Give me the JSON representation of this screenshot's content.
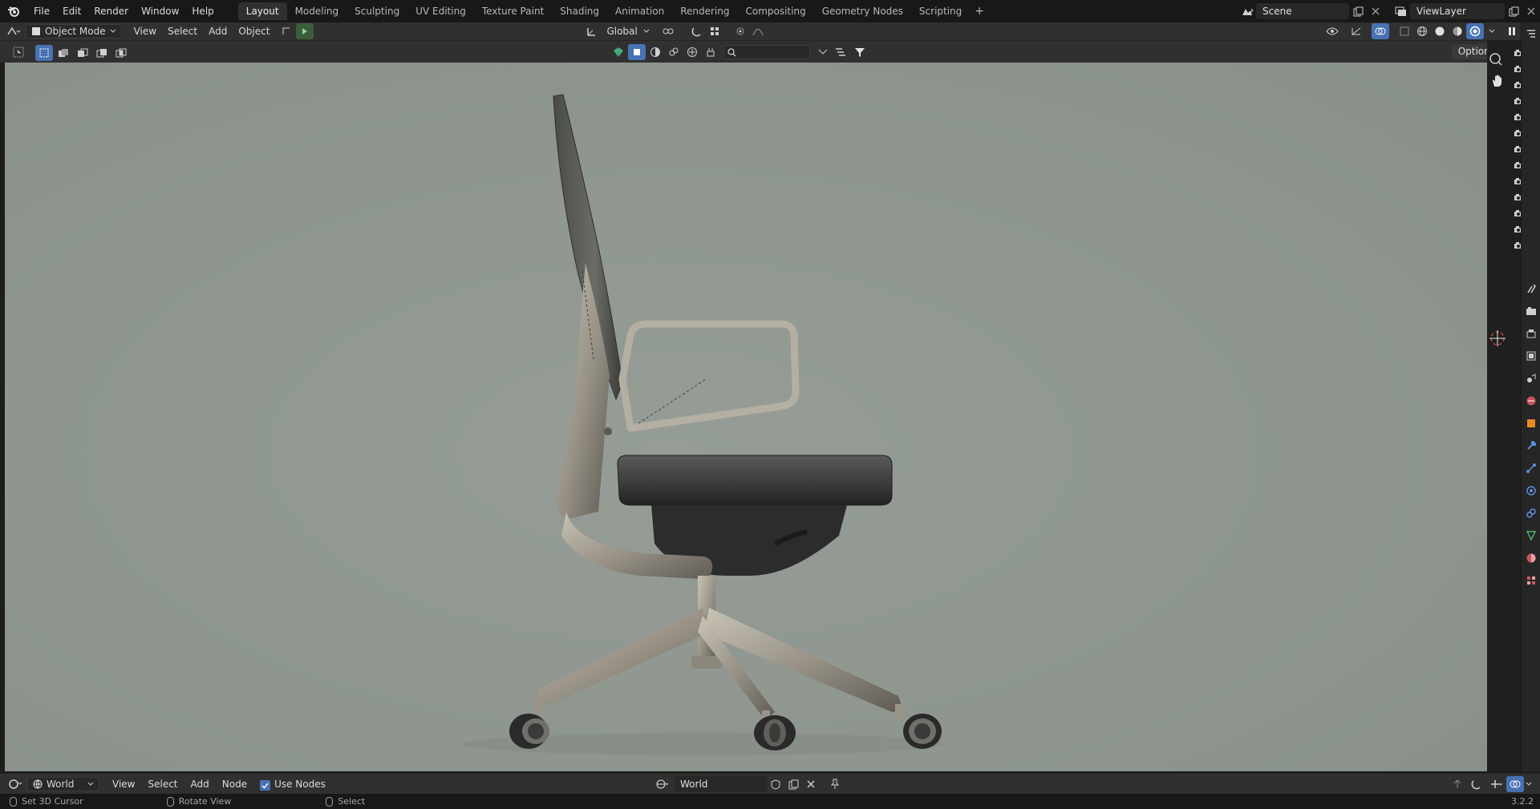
{
  "topbar": {
    "menus": [
      "File",
      "Edit",
      "Render",
      "Window",
      "Help"
    ],
    "workspaces": [
      "Layout",
      "Modeling",
      "Sculpting",
      "UV Editing",
      "Texture Paint",
      "Shading",
      "Animation",
      "Rendering",
      "Compositing",
      "Geometry Nodes",
      "Scripting"
    ],
    "active_workspace": "Layout",
    "add_tab": "+",
    "scene": "Scene",
    "view_layer": "ViewLayer"
  },
  "viewport_header": {
    "mode": "Object Mode",
    "menus": [
      "View",
      "Select",
      "Add",
      "Object"
    ],
    "orientation": "Global"
  },
  "tool_header": {
    "options": "Options"
  },
  "node_header": {
    "editor_type": "World",
    "menus": [
      "View",
      "Select",
      "Add",
      "Node"
    ],
    "use_nodes_label": "Use Nodes",
    "use_nodes_checked": true,
    "world_name": "World"
  },
  "statusbar": {
    "left": "Set 3D Cursor",
    "middle": "Rotate View",
    "right": "Select",
    "version": "3.2.2"
  },
  "colors": {
    "accent": "#4772b3",
    "viewport_bg": "#8e968f"
  }
}
